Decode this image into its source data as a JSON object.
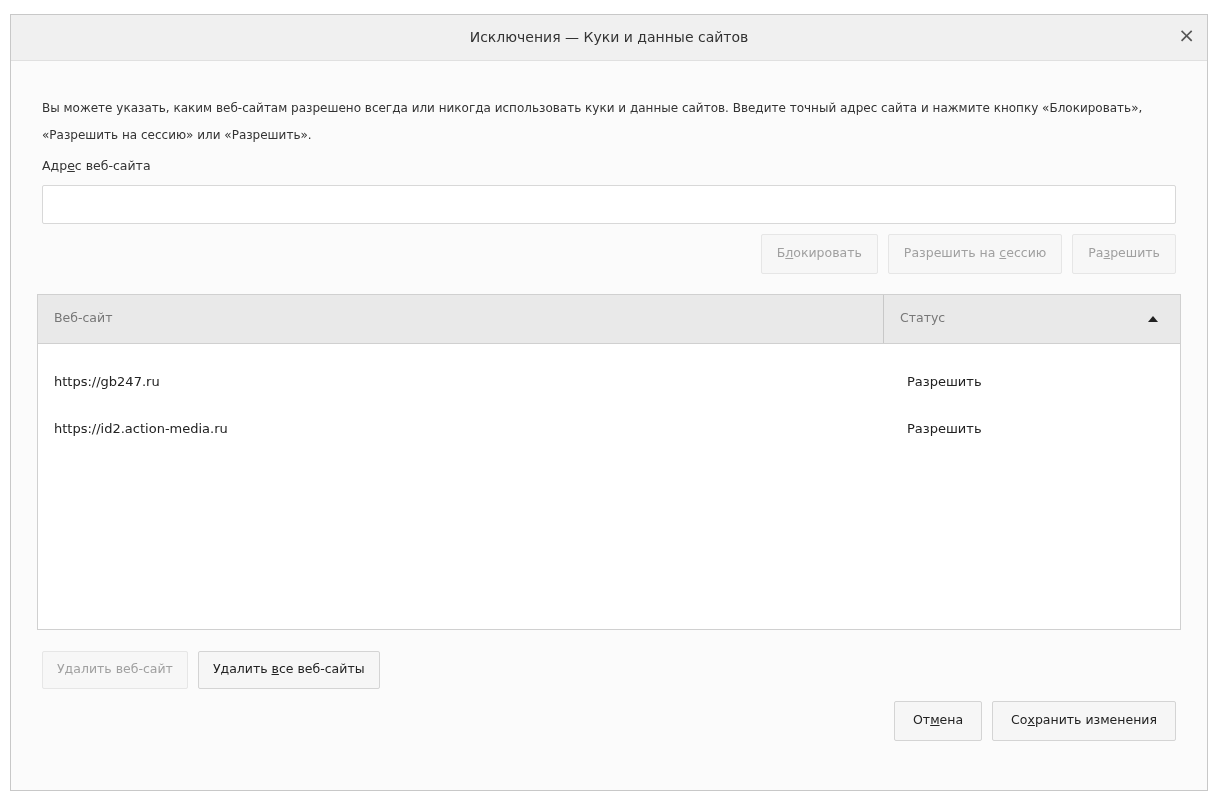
{
  "dialog": {
    "title": "Исключения — Куки и данные сайтов",
    "close": "×"
  },
  "description": "Вы можете указать, каким веб-сайтам разрешено всегда или никогда использовать куки и данные сайтов. Введите точный адрес сайта и нажмите кнопку «Блокировать», «Разрешить на сессию» или «Разрешить».",
  "address_field": {
    "label": {
      "before": "Адр",
      "access_key": "е",
      "after": "с веб-сайта"
    }
  },
  "action_buttons": [
    {
      "label": {
        "before": "Б",
        "access_key": "л",
        "after": "окировать"
      },
      "disabled": true
    },
    {
      "label": {
        "before": "Разрешить на ",
        "access_key": "с",
        "after": "ессию"
      },
      "disabled": true
    },
    {
      "label": {
        "before": "Ра",
        "access_key": "з",
        "after": "решить"
      },
      "disabled": true
    }
  ],
  "table": {
    "columns": [
      {
        "label": "Веб-сайт"
      },
      {
        "label": "Статус",
        "sorted_ascending": true
      }
    ],
    "rows": [
      {
        "site": "https://gb247.ru",
        "status": "Разрешить"
      },
      {
        "site": "https://id2.action-media.ru",
        "status": "Разрешить"
      }
    ]
  },
  "remove_buttons": [
    {
      "label": {
        "before": "Удалить веб-сайт"
      },
      "disabled": true
    },
    {
      "label": {
        "before": "Удалить ",
        "access_key": "в",
        "after": "се веб-сайты"
      },
      "disabled": false
    }
  ],
  "footer_buttons": [
    {
      "label": {
        "before": "От",
        "access_key": "м",
        "after": "ена"
      },
      "disabled": false
    },
    {
      "label": {
        "before": "Со",
        "access_key": "х",
        "after": "ранить изменения"
      },
      "disabled": false
    }
  ]
}
